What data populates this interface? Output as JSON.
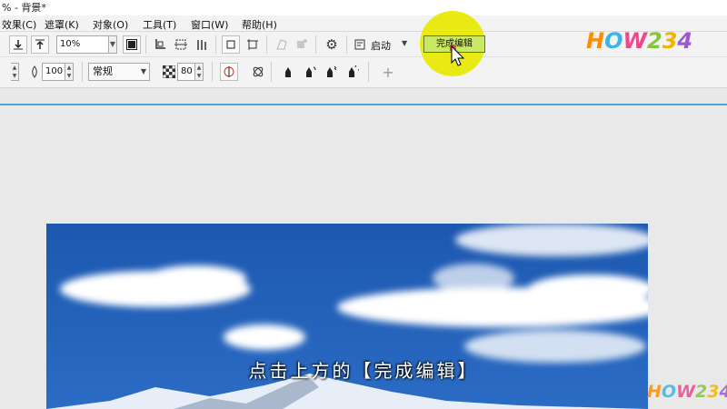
{
  "window": {
    "title": "% - 背景*"
  },
  "menu": [
    {
      "label": "效果(C)"
    },
    {
      "label": "遮罩(K)"
    },
    {
      "label": "对象(O)"
    },
    {
      "label": "工具(T)"
    },
    {
      "label": "窗口(W)"
    },
    {
      "label": "帮助(H)"
    }
  ],
  "toolbar": {
    "zoom_value": "10%",
    "launch_label": "启动",
    "finish_edit_label": "完成编辑"
  },
  "toolbar2": {
    "size_value": "100",
    "mode_value": "常规",
    "opacity_value": "80"
  },
  "brand": {
    "logo_text": [
      "H",
      "O",
      "W",
      "2",
      "3",
      "4"
    ]
  },
  "subtitle": "点击上方的【完成编辑】",
  "colors": {
    "accent": "#4aa7d8",
    "highlight": "#e8e800",
    "button_active": "#c9e866"
  }
}
